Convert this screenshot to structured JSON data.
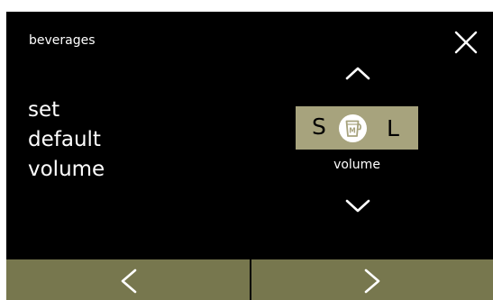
{
  "header": {
    "category": "beverages",
    "close_icon": "close-icon"
  },
  "setting": {
    "title_lines": [
      "set",
      "default",
      "volume"
    ]
  },
  "selector": {
    "small_label": "S",
    "large_label": "L",
    "medium_icon": "cup-medium-icon",
    "medium_icon_letter": "M",
    "parameter_label": "volume",
    "up_icon": "chevron-up-icon",
    "down_icon": "chevron-down-icon"
  },
  "navigation": {
    "prev_icon": "chevron-left-icon",
    "next_icon": "chevron-right-icon"
  },
  "colors": {
    "background": "#000000",
    "selector_fill": "#a7a37d",
    "nav_fill": "#77774e",
    "text": "#ffffff"
  }
}
